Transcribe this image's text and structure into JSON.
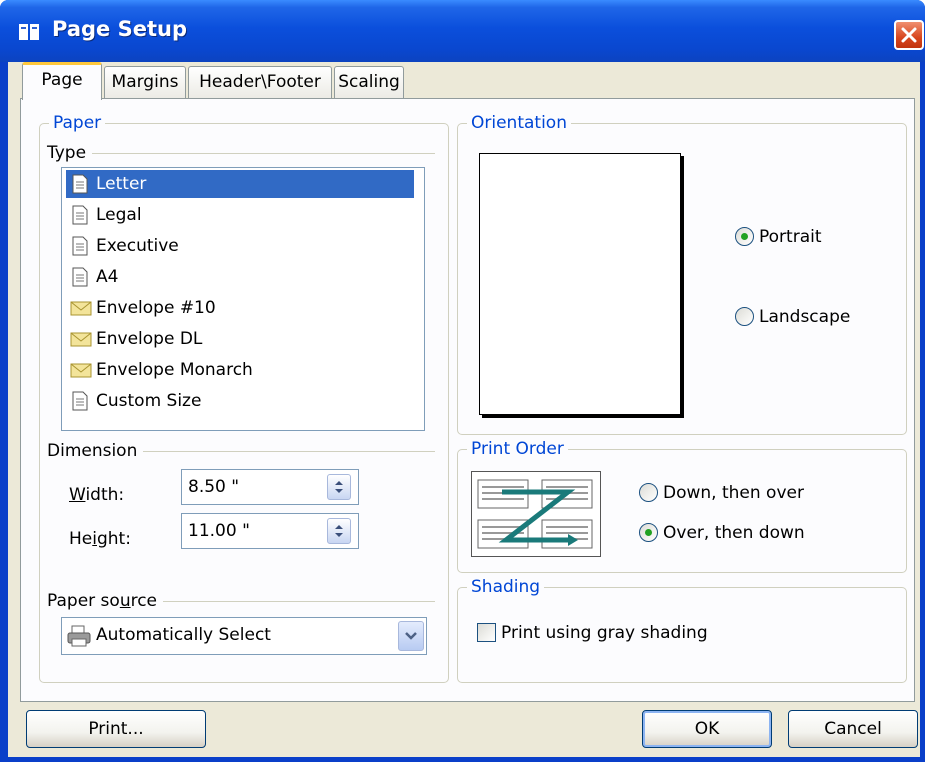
{
  "window": {
    "title": "Page Setup"
  },
  "tabs": [
    {
      "label": "Page",
      "active": true
    },
    {
      "label": "Margins",
      "active": false
    },
    {
      "label": "Header\\Footer",
      "active": false
    },
    {
      "label": "Scaling",
      "active": false
    }
  ],
  "paper": {
    "group_label": "Paper",
    "type_label": "Type",
    "types": [
      {
        "label": "Letter",
        "icon": "page-icon",
        "selected": true
      },
      {
        "label": "Legal",
        "icon": "page-icon",
        "selected": false
      },
      {
        "label": "Executive",
        "icon": "page-icon",
        "selected": false
      },
      {
        "label": "A4",
        "icon": "page-icon",
        "selected": false
      },
      {
        "label": "Envelope #10",
        "icon": "envelope-icon",
        "selected": false
      },
      {
        "label": "Envelope DL",
        "icon": "envelope-icon",
        "selected": false
      },
      {
        "label": "Envelope Monarch",
        "icon": "envelope-icon",
        "selected": false
      },
      {
        "label": "Custom Size",
        "icon": "page-icon",
        "selected": false
      }
    ],
    "dimension_label": "Dimension",
    "width_label_pre": "",
    "width_label_u": "W",
    "width_label_post": "idth:",
    "width_value": "8.50 \"",
    "height_label_pre": "He",
    "height_label_u": "i",
    "height_label_post": "ght:",
    "height_value": "11.00 \"",
    "source_label_pre": "Paper so",
    "source_label_u": "u",
    "source_label_post": "rce",
    "source_value": "Automatically Select"
  },
  "orientation": {
    "group_label": "Orientation",
    "portrait_label": "Portrait",
    "landscape_label": "Landscape",
    "selected": "Portrait"
  },
  "print_order": {
    "group_label": "Print Order",
    "down_then_over": "Down, then over",
    "over_then_down": "Over, then down",
    "selected": "Over, then down"
  },
  "shading": {
    "group_label": "Shading",
    "checkbox_label": "Print using gray shading",
    "checked": false
  },
  "buttons": {
    "print": "Print...",
    "ok": "OK",
    "cancel": "Cancel"
  },
  "colors": {
    "accent": "#0046d5",
    "selection": "#316ac5",
    "titlebar": "#0b4fdc"
  }
}
